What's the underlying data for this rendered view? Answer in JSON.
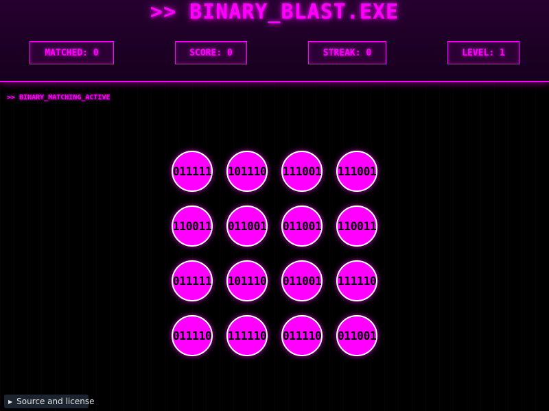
{
  "title": ">> BINARY_BLAST.EXE",
  "stats": {
    "matched": {
      "label": "MATCHED:",
      "value": "0"
    },
    "score": {
      "label": "SCORE:",
      "value": "0"
    },
    "streak": {
      "label": "STREAK:",
      "value": "0"
    },
    "level": {
      "label": "LEVEL:",
      "value": "1"
    }
  },
  "status": ">> BINARY_MATCHING_ACTIVE",
  "grid": {
    "rows": 4,
    "cols": 4,
    "cells": [
      "011111",
      "101110",
      "111001",
      "111001",
      "110011",
      "011001",
      "011001",
      "110011",
      "011111",
      "101110",
      "011001",
      "111110",
      "011110",
      "111110",
      "011110",
      "011001"
    ]
  },
  "footer": {
    "source_label": "Source and license",
    "source_icon": "triangle-right-icon"
  },
  "colors": {
    "accent": "#ff00ff",
    "background": "#000000",
    "header_bg": "#1f0026",
    "orb_border": "#ffffff",
    "orb_text": "#000000"
  }
}
